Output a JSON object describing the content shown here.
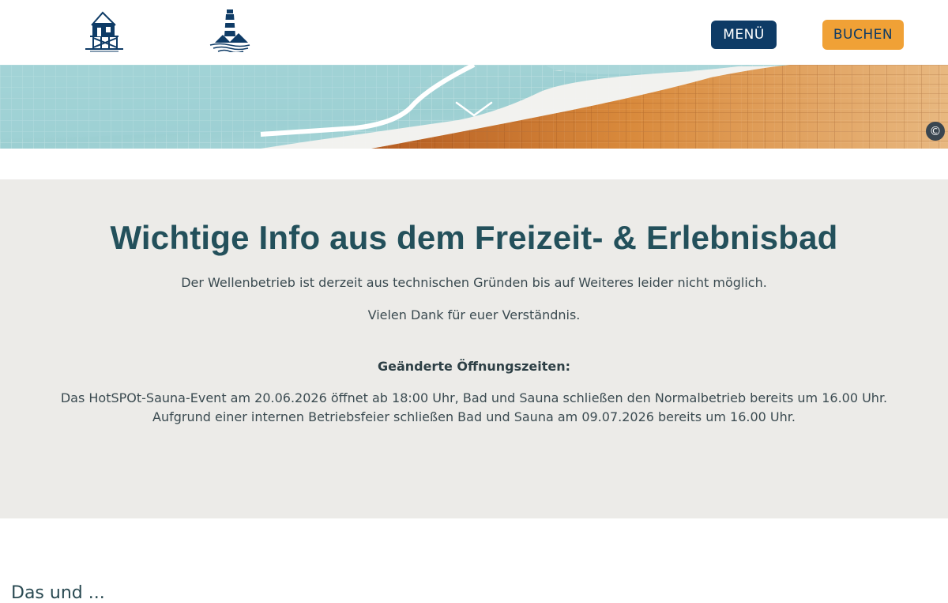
{
  "header": {
    "menu_label": "MENÜ",
    "book_label": "BUCHEN",
    "menu_color": "#0e3b66",
    "book_color": "#f0a136"
  },
  "hero": {
    "copyright_symbol": "©",
    "scroll_icon": "chevron-down-icon"
  },
  "info": {
    "title": "Wichtige Info aus dem Freizeit- & Erlebnisbad",
    "paragraph_1": "Der Wellenbetrieb ist derzeit aus technischen Gründen bis auf Weiteres leider nicht möglich.",
    "paragraph_2": "Vielen Dank für euer Verständnis.",
    "subheading": "Geänderte Öffnungszeiten:",
    "line_1": "Das HotSPOt-Sauna-Event am 20.06.2026 öffnet ab 18:00 Uhr, Bad und Sauna schließen den Normalbetrieb bereits um 16.00 Uhr.",
    "line_2": "Aufgrund einer internen Betriebsfeier schließen Bad und Sauna am 09.07.2026 bereits um 16.00 Uhr."
  },
  "below": {
    "text": "Das und ... "
  }
}
